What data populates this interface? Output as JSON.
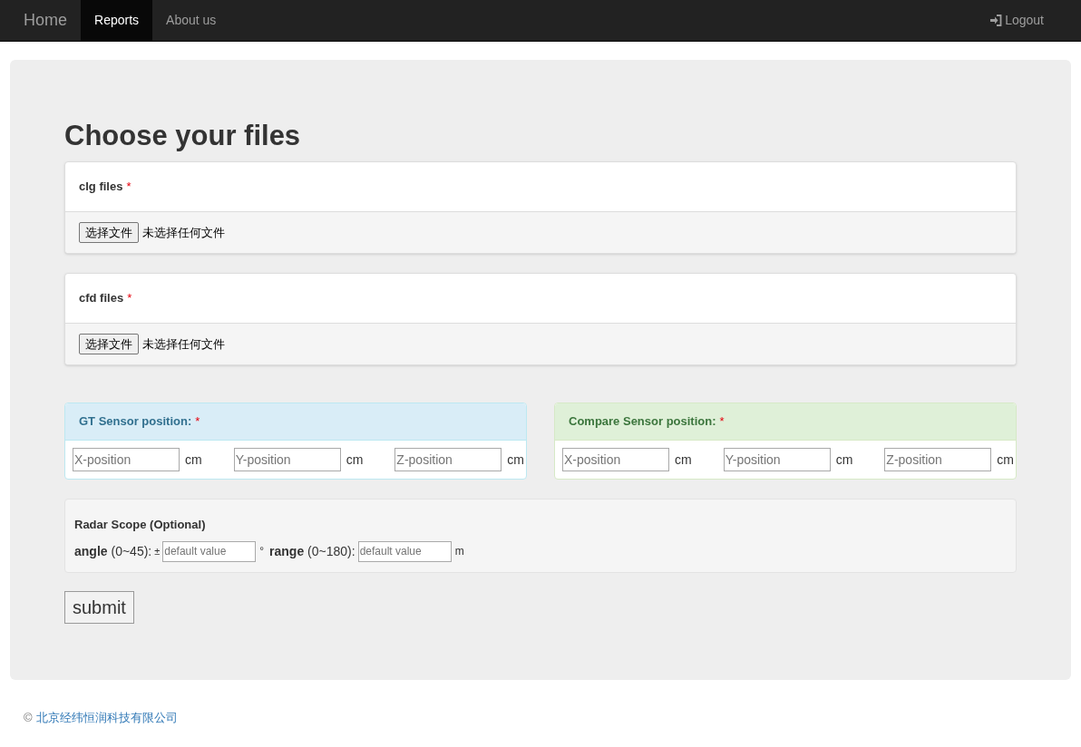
{
  "nav": {
    "brand": "Home",
    "items": [
      {
        "label": "Reports",
        "selected": true
      },
      {
        "label": "About us",
        "selected": false
      }
    ],
    "logout": "Logout"
  },
  "heading": "Choose your files",
  "file_panels": [
    {
      "label": "clg files",
      "required_mark": "*",
      "button": "选择文件",
      "status": "未选择任何文件"
    },
    {
      "label": "cfd files",
      "required_mark": "*",
      "button": "选择文件",
      "status": "未选择任何文件"
    }
  ],
  "sensor_panels": [
    {
      "kind": "info",
      "title": "GT Sensor position:",
      "required_mark": "*",
      "fields": [
        {
          "placeholder": "X-position",
          "unit": "cm"
        },
        {
          "placeholder": "Y-position",
          "unit": "cm"
        },
        {
          "placeholder": "Z-position",
          "unit": "cm"
        }
      ]
    },
    {
      "kind": "success",
      "title": "Compare Sensor position:",
      "required_mark": "*",
      "fields": [
        {
          "placeholder": "X-position",
          "unit": "cm"
        },
        {
          "placeholder": "Y-position",
          "unit": "cm"
        },
        {
          "placeholder": "Z-position",
          "unit": "cm"
        }
      ]
    }
  ],
  "radar": {
    "title": "Radar Scope (Optional)",
    "params": [
      {
        "label": "angle",
        "hint": "(0~45):",
        "prefix": "±",
        "placeholder": "default value",
        "unit": "°"
      },
      {
        "label": "range",
        "hint": "(0~180):",
        "placeholder": "default value",
        "unit": "m"
      }
    ]
  },
  "submit": "submit",
  "footer": {
    "symbol": "©",
    "company": "北京经纬恒润科技有限公司"
  }
}
